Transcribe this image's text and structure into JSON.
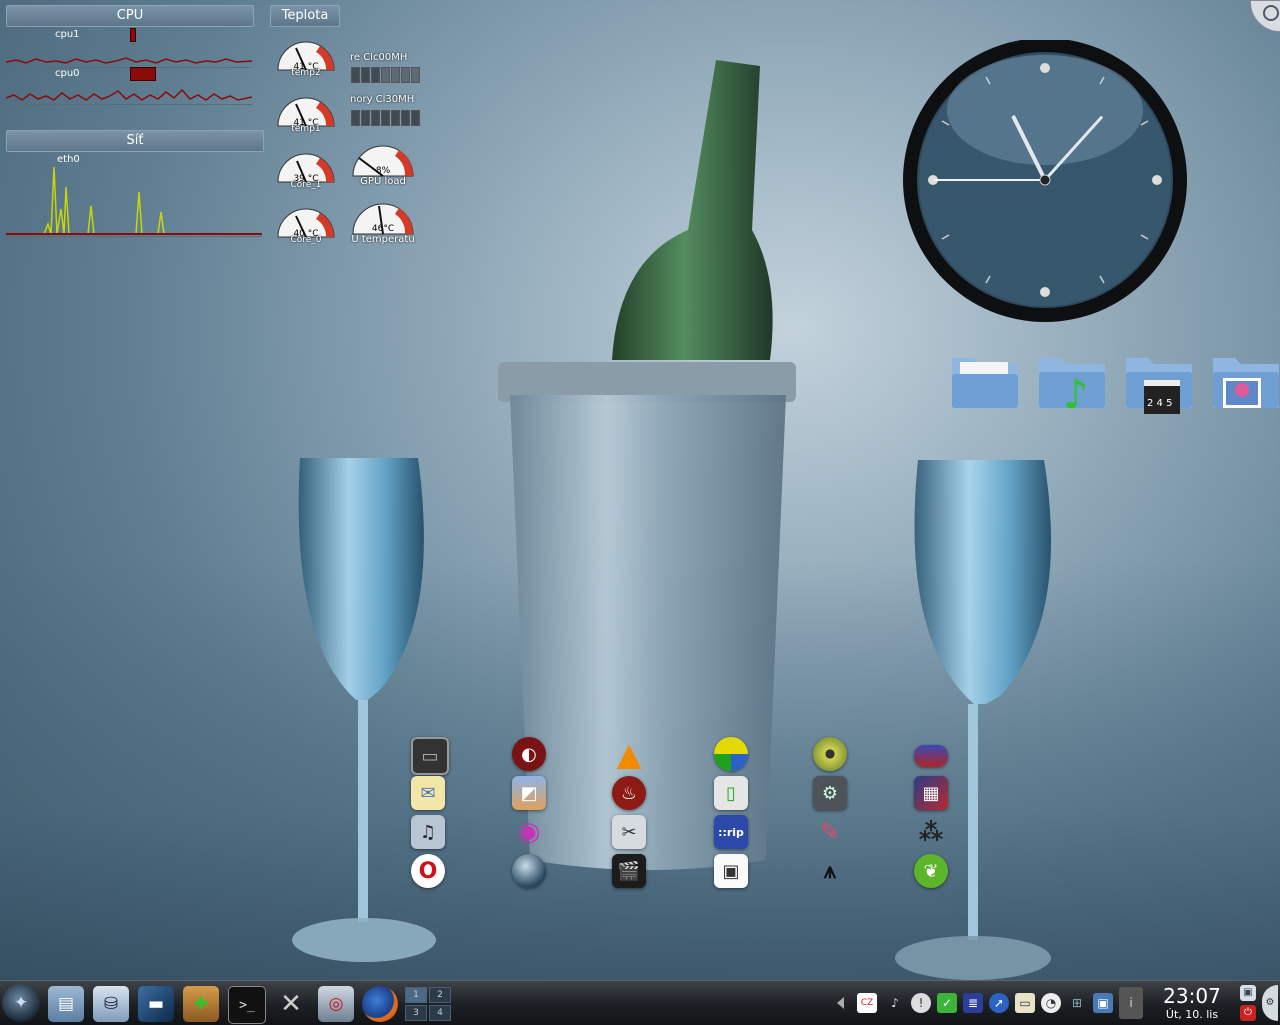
{
  "monitors": {
    "cpu": {
      "title": "CPU",
      "core1_label": "cpu1",
      "core0_label": "cpu0"
    },
    "network": {
      "title": "Síť",
      "iface_label": "eth0"
    },
    "temperature": {
      "title": "Teplota",
      "gauges": [
        {
          "label": "temp2",
          "value": "41 °C"
        },
        {
          "label": "temp1",
          "value": "41 °C"
        },
        {
          "label": "Core_1",
          "value": "39 °C"
        },
        {
          "label": "Core_0",
          "value": "40 °C"
        }
      ],
      "gpu_clock_label": "re Clc00MH",
      "gpu_memory_label": "nory Cl30MH",
      "gpu_load": {
        "label": "GPU load",
        "value": "8%"
      },
      "gpu_temp": {
        "label": "U temperatu",
        "value": "46°C"
      }
    }
  },
  "clock_widget": {
    "hour": 11,
    "minute": 7,
    "second": 45
  },
  "folders": [
    "documents-folder",
    "music-folder",
    "videos-folder",
    "pictures-folder"
  ],
  "taskbar": {
    "pager": [
      "1",
      "2",
      "3",
      "4"
    ],
    "clock_time": "23:07",
    "clock_date": "Út, 10. lis"
  },
  "colors": {
    "accent_red": "#8b0b0b",
    "graph_green": "#c9d40a",
    "taskbar_dark": "#1d2024"
  }
}
